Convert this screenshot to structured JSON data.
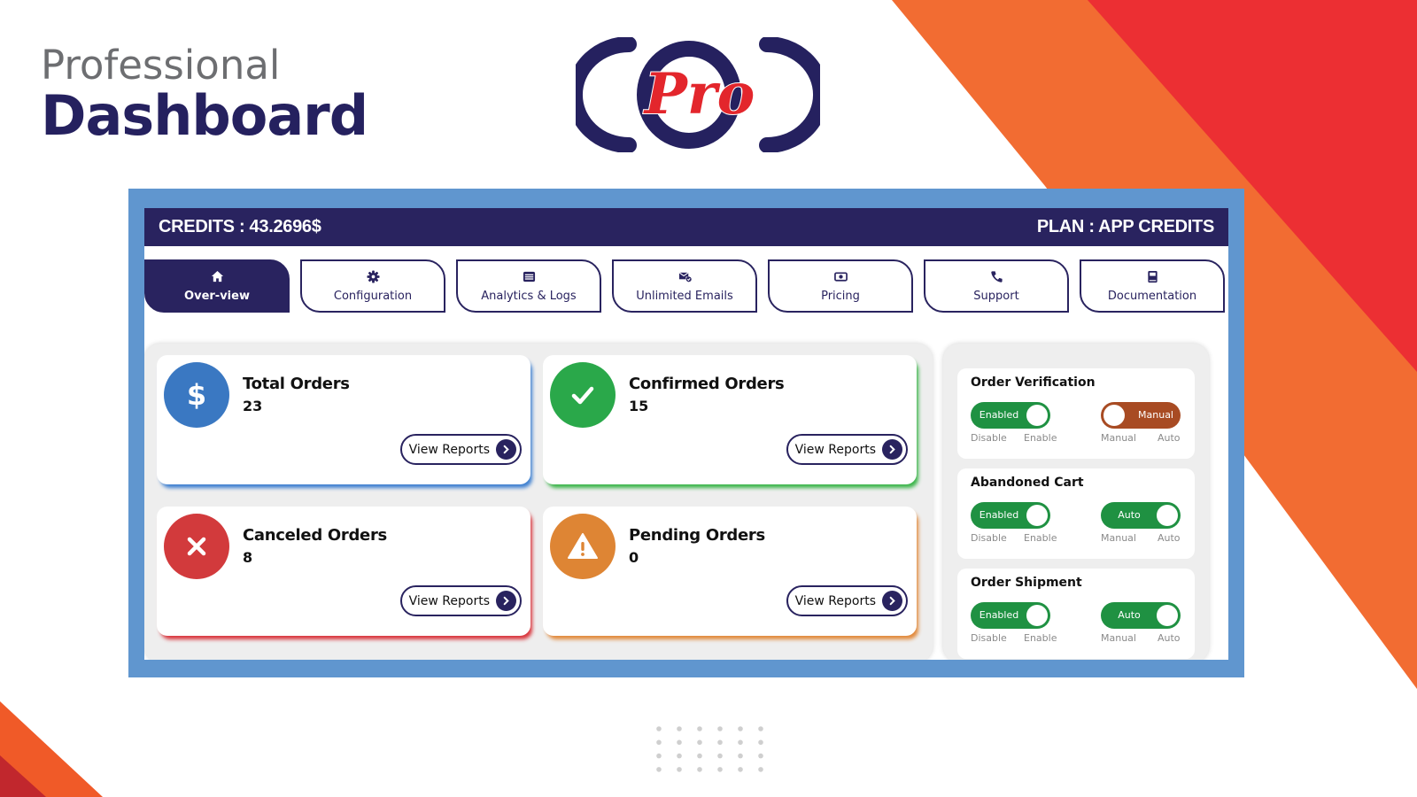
{
  "branding": {
    "subtitle": "Professional",
    "title": "Dashboard",
    "logo_text": "Pro"
  },
  "colors": {
    "navy": "#29235f",
    "frame_blue": "#6096cf",
    "bg_orange": "#f26c32",
    "bg_red": "#ec2f33",
    "stat_blue": "#3a78c2",
    "stat_green": "#2aa84a",
    "stat_red": "#d23a3c",
    "stat_orange": "#de8534",
    "toggle_green": "#1f9142",
    "toggle_brown": "#a84b23"
  },
  "header": {
    "credits": "CREDITS : 43.2696$",
    "plan": "PLAN : APP CREDITS"
  },
  "tabs": [
    {
      "label": "Over-view",
      "icon": "home-icon",
      "active": true
    },
    {
      "label": "Configuration",
      "icon": "gear-icon",
      "active": false
    },
    {
      "label": "Analytics & Logs",
      "icon": "list-icon",
      "active": false
    },
    {
      "label": "Unlimited Emails",
      "icon": "email-check-icon",
      "active": false
    },
    {
      "label": "Pricing",
      "icon": "money-icon",
      "active": false
    },
    {
      "label": "Support",
      "icon": "phone-icon",
      "active": false
    },
    {
      "label": "Documentation",
      "icon": "book-icon",
      "active": false
    }
  ],
  "stats": [
    {
      "title": "Total Orders",
      "value": "23",
      "icon": "dollar-icon",
      "button": "View Reports"
    },
    {
      "title": "Confirmed Orders",
      "value": "15",
      "icon": "check-icon",
      "button": "View Reports"
    },
    {
      "title": "Canceled Orders",
      "value": "8",
      "icon": "x-icon",
      "button": "View Reports"
    },
    {
      "title": "Pending Orders",
      "value": "0",
      "icon": "warning-icon",
      "button": "View Reports"
    }
  ],
  "settings": [
    {
      "title": "Order Verification",
      "status_toggle": {
        "label": "Enabled",
        "state": "on",
        "caption_left": "Disable",
        "caption_right": "Enable"
      },
      "mode_toggle": {
        "label": "Manual",
        "state": "off",
        "caption_left": "Manual",
        "caption_right": "Auto"
      }
    },
    {
      "title": "Abandoned Cart",
      "status_toggle": {
        "label": "Enabled",
        "state": "on",
        "caption_left": "Disable",
        "caption_right": "Enable"
      },
      "mode_toggle": {
        "label": "Auto",
        "state": "on",
        "caption_left": "Manual",
        "caption_right": "Auto"
      }
    },
    {
      "title": "Order Shipment",
      "status_toggle": {
        "label": "Enabled",
        "state": "on",
        "caption_left": "Disable",
        "caption_right": "Enable"
      },
      "mode_toggle": {
        "label": "Auto",
        "state": "on",
        "caption_left": "Manual",
        "caption_right": "Auto"
      }
    }
  ]
}
